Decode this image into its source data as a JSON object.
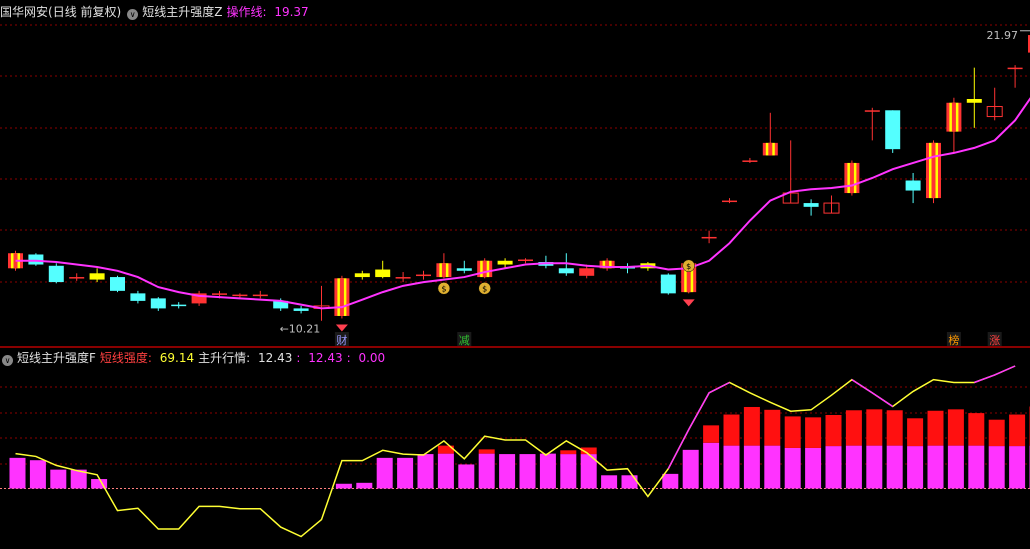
{
  "upper_legend": {
    "stock": "国华网安",
    "period": "(日线 前复权)",
    "indicator": "短线主升强度Z",
    "line_label": "操作线",
    "line_value": "19.37"
  },
  "lower_legend": {
    "indicator": "短线主升强度F",
    "strength_label": "短线强度",
    "strength_value": "69.14",
    "trend_label": "主升行情",
    "trend_value": "12.43",
    "v3": "12.43",
    "v4": "0.00"
  },
  "colors": {
    "up": "#ff3333",
    "down": "#54ffff",
    "line_magenta": "#ff33ff",
    "line_yellow": "#ffff33",
    "grid": "#8b0000",
    "text": "#c0c0c0",
    "zt_yellow": "#ffff00"
  },
  "chart_data": [
    {
      "type": "candlestick",
      "y_range": [
        9.6,
        22.2
      ],
      "annotations": {
        "high": "21.97",
        "low": "10.21"
      },
      "candles": [
        {
          "o": 12.3,
          "c": 12.9,
          "h": 13.0,
          "l": 12.2,
          "s": "zt"
        },
        {
          "o": 12.85,
          "c": 12.45,
          "h": 12.9,
          "l": 12.4,
          "s": "dn"
        },
        {
          "o": 12.4,
          "c": 11.75,
          "h": 12.5,
          "l": 11.7,
          "s": "dn"
        },
        {
          "o": 11.9,
          "c": 11.95,
          "h": 12.1,
          "l": 11.8,
          "s": "up"
        },
        {
          "o": 11.85,
          "c": 12.1,
          "h": 12.3,
          "l": 11.75,
          "s": "yl"
        },
        {
          "o": 11.95,
          "c": 11.4,
          "h": 12.0,
          "l": 11.35,
          "s": "dn"
        },
        {
          "o": 11.3,
          "c": 11.0,
          "h": 11.4,
          "l": 10.9,
          "s": "dn"
        },
        {
          "o": 11.1,
          "c": 10.7,
          "h": 11.15,
          "l": 10.6,
          "s": "dn"
        },
        {
          "o": 10.85,
          "c": 10.8,
          "h": 10.95,
          "l": 10.7,
          "s": "dn"
        },
        {
          "o": 10.9,
          "c": 11.3,
          "h": 11.4,
          "l": 10.8,
          "s": "up"
        },
        {
          "o": 11.2,
          "c": 11.3,
          "h": 11.4,
          "l": 11.1,
          "s": "up"
        },
        {
          "o": 11.25,
          "c": 11.2,
          "h": 11.3,
          "l": 11.1,
          "s": "up"
        },
        {
          "o": 11.2,
          "c": 11.25,
          "h": 11.4,
          "l": 11.1,
          "s": "up"
        },
        {
          "o": 11.0,
          "c": 10.7,
          "h": 11.1,
          "l": 10.6,
          "s": "dn"
        },
        {
          "o": 10.7,
          "c": 10.6,
          "h": 10.8,
          "l": 10.5,
          "s": "dn"
        },
        {
          "o": 10.7,
          "c": 10.8,
          "h": 11.6,
          "l": 10.21,
          "s": "none"
        },
        {
          "o": 10.4,
          "c": 11.9,
          "h": 12.0,
          "l": 10.3,
          "s": "zt"
        },
        {
          "o": 11.95,
          "c": 12.1,
          "h": 12.2,
          "l": 11.85,
          "s": "yl"
        },
        {
          "o": 11.95,
          "c": 12.25,
          "h": 12.6,
          "l": 11.9,
          "s": "yl"
        },
        {
          "o": 11.95,
          "c": 11.95,
          "h": 12.15,
          "l": 11.75,
          "s": "up"
        },
        {
          "o": 11.95,
          "c": 12.05,
          "h": 12.2,
          "l": 11.85,
          "s": "up"
        },
        {
          "o": 11.95,
          "c": 12.5,
          "h": 12.9,
          "l": 11.9,
          "s": "zt"
        },
        {
          "o": 12.3,
          "c": 12.2,
          "h": 12.6,
          "l": 12.1,
          "s": "dn"
        },
        {
          "o": 11.95,
          "c": 12.6,
          "h": 12.7,
          "l": 11.9,
          "s": "zt"
        },
        {
          "o": 12.6,
          "c": 12.45,
          "h": 12.7,
          "l": 12.3,
          "s": "yl"
        },
        {
          "o": 12.55,
          "c": 12.65,
          "h": 12.7,
          "l": 12.5,
          "s": "up"
        },
        {
          "o": 12.55,
          "c": 12.4,
          "h": 12.8,
          "l": 12.3,
          "s": "dn"
        },
        {
          "o": 12.3,
          "c": 12.1,
          "h": 12.9,
          "l": 12.0,
          "s": "dn"
        },
        {
          "o": 12.3,
          "c": 12.0,
          "h": 12.45,
          "l": 11.9,
          "s": "up"
        },
        {
          "o": 12.3,
          "c": 12.6,
          "h": 12.7,
          "l": 12.2,
          "s": "zt"
        },
        {
          "o": 12.35,
          "c": 12.35,
          "h": 12.5,
          "l": 12.1,
          "s": "dn"
        },
        {
          "o": 12.5,
          "c": 12.3,
          "h": 12.55,
          "l": 12.2,
          "s": "yl"
        },
        {
          "o": 12.05,
          "c": 11.3,
          "h": 12.1,
          "l": 11.25,
          "s": "dn"
        },
        {
          "o": 11.35,
          "c": 12.5,
          "h": 12.6,
          "l": 11.3,
          "s": "zt"
        },
        {
          "o": 13.55,
          "c": 13.55,
          "h": 13.8,
          "l": 13.3,
          "s": "up"
        },
        {
          "o": 15.0,
          "c": 15.0,
          "h": 15.1,
          "l": 14.9,
          "s": "up"
        },
        {
          "o": 16.6,
          "c": 16.6,
          "h": 16.7,
          "l": 16.5,
          "s": "up"
        },
        {
          "o": 16.8,
          "c": 17.3,
          "h": 18.5,
          "l": 16.8,
          "s": "zt"
        },
        {
          "o": 14.9,
          "c": 15.3,
          "h": 17.4,
          "l": 14.9,
          "s": "none"
        },
        {
          "o": 14.9,
          "c": 14.75,
          "h": 15.05,
          "l": 14.4,
          "s": "dn"
        },
        {
          "o": 14.5,
          "c": 14.9,
          "h": 15.2,
          "l": 14.5,
          "s": "none"
        },
        {
          "o": 15.3,
          "c": 16.5,
          "h": 16.6,
          "l": 15.2,
          "s": "zt"
        },
        {
          "o": 18.6,
          "c": 18.6,
          "h": 18.7,
          "l": 17.4,
          "s": "up"
        },
        {
          "o": 18.6,
          "c": 17.05,
          "h": 18.6,
          "l": 16.9,
          "s": "dn"
        },
        {
          "o": 15.8,
          "c": 15.4,
          "h": 16.1,
          "l": 14.9,
          "s": "dn"
        },
        {
          "o": 15.1,
          "c": 17.3,
          "h": 17.4,
          "l": 14.9,
          "s": "zt"
        },
        {
          "o": 17.75,
          "c": 18.9,
          "h": 19.1,
          "l": 16.9,
          "s": "zt"
        },
        {
          "o": 18.9,
          "c": 19.05,
          "h": 20.3,
          "l": 17.9,
          "s": "yl"
        },
        {
          "o": 18.35,
          "c": 18.75,
          "h": 19.5,
          "l": 18.2,
          "s": "none"
        },
        {
          "o": 20.3,
          "c": 20.3,
          "h": 20.4,
          "l": 19.5,
          "s": "up"
        },
        {
          "o": 20.9,
          "c": 21.6,
          "h": 21.97,
          "l": 20.7,
          "s": "zt"
        }
      ],
      "ma": [
        12.6,
        12.6,
        12.55,
        12.45,
        12.35,
        12.2,
        11.95,
        11.55,
        11.35,
        11.2,
        11.15,
        11.1,
        11.05,
        11.0,
        10.85,
        10.7,
        10.75,
        11.05,
        11.35,
        11.6,
        11.75,
        11.85,
        11.95,
        12.15,
        12.3,
        12.45,
        12.5,
        12.5,
        12.4,
        12.35,
        12.35,
        12.4,
        12.25,
        12.3,
        12.6,
        13.3,
        14.2,
        15.0,
        15.35,
        15.45,
        15.5,
        15.6,
        15.9,
        16.25,
        16.5,
        16.75,
        16.9,
        17.1,
        17.4,
        18.2,
        19.37
      ],
      "signals": [
        {
          "i": 16,
          "kind": "gem"
        },
        {
          "i": 21,
          "kind": "bag"
        },
        {
          "i": 23,
          "kind": "bag"
        },
        {
          "i": 33,
          "kind": "gem"
        },
        {
          "i": 33,
          "kind": "bag2"
        }
      ],
      "markers": [
        {
          "i": 16,
          "text": "财",
          "color": "#9999ff"
        },
        {
          "i": 22,
          "text": "减",
          "color": "#30c030"
        },
        {
          "i": 46,
          "text": "榜",
          "color": "#ff9900"
        },
        {
          "i": 48,
          "text": "涨",
          "color": "#ff4040"
        }
      ]
    },
    {
      "type": "bar",
      "y_range": [
        -12,
        26
      ],
      "base": [
        6.5,
        6,
        4,
        4,
        2,
        null,
        null,
        null,
        null,
        null,
        null,
        null,
        null,
        null,
        null,
        null,
        1,
        1.2,
        6.5,
        6.5,
        7.3,
        7.4,
        5.1,
        7.4,
        7.3,
        7.3,
        7.4,
        7.3,
        7.3,
        2.8,
        2.8,
        null,
        3.1,
        8.2,
        9.7,
        9.1,
        9.1,
        9.1,
        8.6,
        8.6,
        9,
        9.1,
        9.1,
        9.1,
        9,
        9.1,
        9.1,
        9.1,
        9,
        9,
        9.1
      ],
      "red": [
        0,
        0,
        0,
        0,
        0,
        0,
        0,
        0,
        0,
        0,
        0,
        0,
        0,
        0,
        0,
        0,
        0,
        0,
        0,
        0,
        0,
        1.7,
        0,
        0.9,
        0,
        0,
        0,
        0.8,
        1.4,
        0,
        0,
        0,
        0,
        0,
        3.7,
        6.6,
        8.2,
        7.6,
        6.7,
        6.5,
        6.6,
        7.5,
        7.7,
        7.5,
        5.9,
        7.4,
        7.7,
        6.9,
        5.6,
        6.7,
        8.3
      ],
      "strength_line": [
        7.4,
        6.8,
        4.9,
        3.8,
        2.9,
        -4.7,
        -4.2,
        -8.6,
        -8.6,
        -3.8,
        -3.8,
        -4.3,
        -4.3,
        -8.2,
        -10.2,
        -6.6,
        5.9,
        5.9,
        8.1,
        7.3,
        7.1,
        10.1,
        6.3,
        11.1,
        10.3,
        10.3,
        7.1,
        10.1,
        7.6,
        3.9,
        4.2,
        -1.7,
        4.2,
        12.5,
        20.3,
        22.5,
        20.3,
        18.3,
        16.4,
        16.7,
        19.8,
        23.1,
        20.3,
        17.4,
        20.6,
        23.1,
        22.5,
        22.5,
        24.1,
        26.0
      ],
      "strength_line_value": "69.14",
      "trend_value": "12.43"
    }
  ]
}
